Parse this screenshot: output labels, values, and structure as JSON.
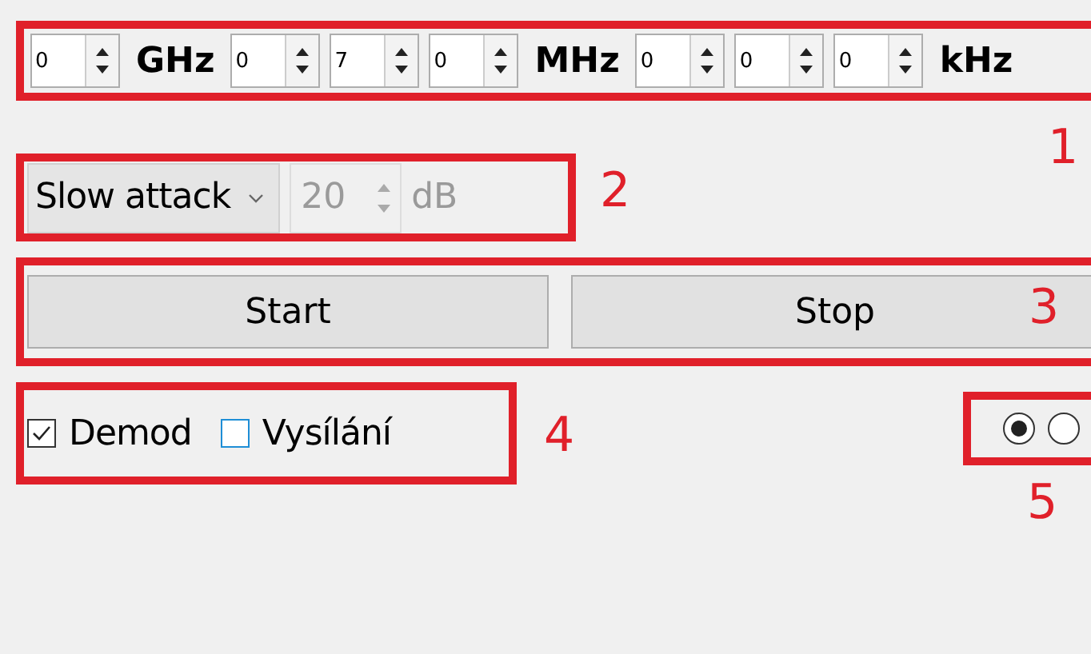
{
  "frequency_row": [
    {
      "kind": "spin",
      "value": "0"
    },
    {
      "kind": "unit",
      "label": "GHz"
    },
    {
      "kind": "spin",
      "value": "0"
    },
    {
      "kind": "spin",
      "value": "7"
    },
    {
      "kind": "spin",
      "value": "0"
    },
    {
      "kind": "unit",
      "label": "MHz"
    },
    {
      "kind": "spin",
      "value": "0"
    },
    {
      "kind": "spin",
      "value": "0"
    },
    {
      "kind": "spin",
      "value": "0"
    },
    {
      "kind": "unit",
      "label": "kHz"
    }
  ],
  "agc": {
    "mode": "Slow attack",
    "gain": {
      "value": "20",
      "unit": "dB",
      "disabled": true
    }
  },
  "buttons": [
    "Start",
    "Stop"
  ],
  "checkboxes": [
    {
      "label": "Demod",
      "checked": true
    },
    {
      "label": "Vysílání",
      "checked": false
    }
  ],
  "radios": [
    {
      "selected": true
    },
    {
      "selected": false
    }
  ],
  "annotations": [
    {
      "label": "1"
    },
    {
      "label": "2"
    },
    {
      "label": "3"
    },
    {
      "label": "4"
    },
    {
      "label": "5"
    }
  ]
}
